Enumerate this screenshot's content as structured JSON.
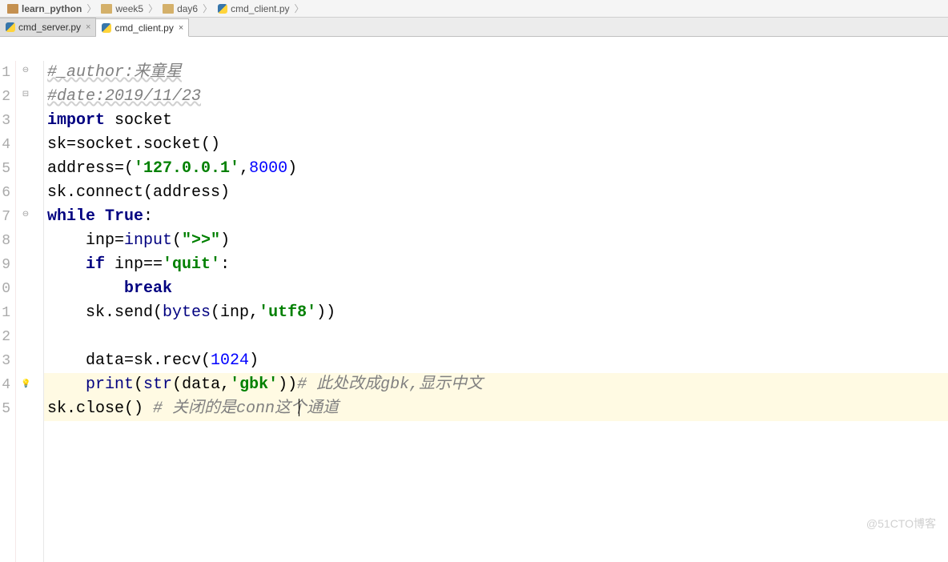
{
  "breadcrumb": [
    {
      "label": "learn_python",
      "icon": "folder-root"
    },
    {
      "label": "week5",
      "icon": "folder"
    },
    {
      "label": "day6",
      "icon": "folder"
    },
    {
      "label": "cmd_client.py",
      "icon": "py"
    }
  ],
  "tabs": [
    {
      "label": "cmd_server.py",
      "active": false
    },
    {
      "label": "cmd_client.py",
      "active": true
    }
  ],
  "gutter": [
    "1",
    "2",
    "3",
    "4",
    "5",
    "6",
    "7",
    "8",
    "9",
    "0",
    "1",
    "2",
    "3",
    "4",
    "5"
  ],
  "code": {
    "line1_comment": "#_author:来童星",
    "line2_comment": "#date:2019/11/23",
    "line3_import": "import",
    "line3_module": " socket",
    "line4": "sk=socket.socket()",
    "line5_pre": "address=(",
    "line5_str": "'127.0.0.1'",
    "line5_mid": ",",
    "line5_num": "8000",
    "line5_post": ")",
    "line6": "sk.connect(address)",
    "line7_while": "while",
    "line7_true": " True",
    "line7_colon": ":",
    "line8_pre": "    inp=",
    "line8_input": "input",
    "line8_paren": "(",
    "line8_str": "\">>\"",
    "line8_close": ")",
    "line9_pre": "    ",
    "line9_if": "if",
    "line9_mid": " inp==",
    "line9_str": "'quit'",
    "line9_colon": ":",
    "line10_pre": "        ",
    "line10_break": "break",
    "line11_pre": "    sk.send(",
    "line11_bytes": "bytes",
    "line11_mid": "(inp,",
    "line11_str": "'utf8'",
    "line11_close": "))",
    "line13_pre": "    data=sk.recv(",
    "line13_num": "1024",
    "line13_close": ")",
    "line14_pre": "    ",
    "line14_print": "print",
    "line14_paren": "(",
    "line14_str_fn": "str",
    "line14_mid": "(data,",
    "line14_str": "'gbk'",
    "line14_close": "))",
    "line14_comment": "# 此处改成gbk,显示中文",
    "line15_pre": "sk.close() ",
    "line15_comment": "# 关闭的是conn这个通道"
  },
  "watermark": "@51CTO博客"
}
